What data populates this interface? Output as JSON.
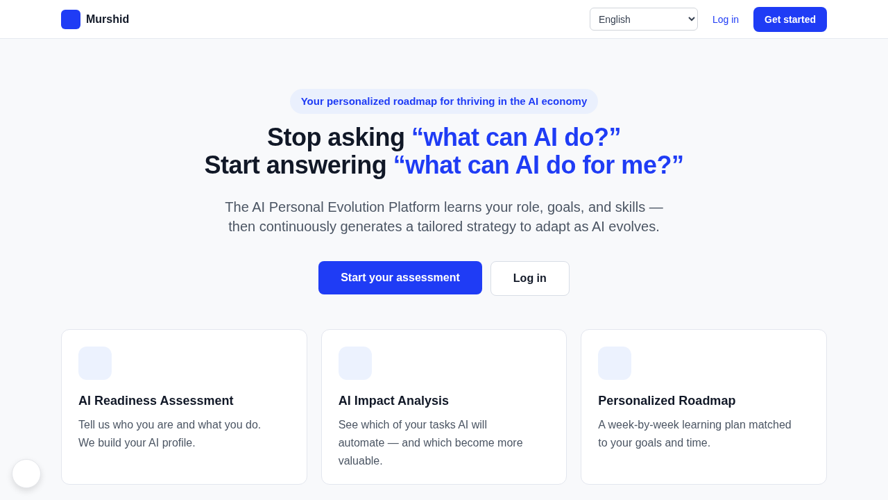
{
  "header": {
    "brand": "Murshid",
    "language_select": {
      "value": "English"
    },
    "login_link": "Log in",
    "cta_button": "Get started"
  },
  "hero": {
    "badge": "Your personalized roadmap for thriving in the AI economy",
    "heading": [
      {
        "lead": "Stop asking",
        "quote": "“what can AI do?”"
      },
      {
        "lead": "Start answering",
        "quote": "“what can AI do for me?”"
      }
    ],
    "subtitle": "The AI Personal Evolution Platform learns your role, goals, and skills — then continuously generates a tailored strategy to adapt as AI evolves.",
    "buttons": [
      {
        "label": "Start your assessment",
        "kind": "primary"
      },
      {
        "label": "Log in",
        "kind": "secondary"
      }
    ]
  },
  "features": [
    {
      "title": "AI Readiness Assessment",
      "description": "Tell us who you are and what you do. We build your AI profile."
    },
    {
      "title": "AI Impact Analysis",
      "description": "See which of your tasks AI will automate — and which become more valuable."
    },
    {
      "title": "Personalized Roadmap",
      "description": "A week-by-week learning plan matched to your goals and time."
    }
  ]
}
